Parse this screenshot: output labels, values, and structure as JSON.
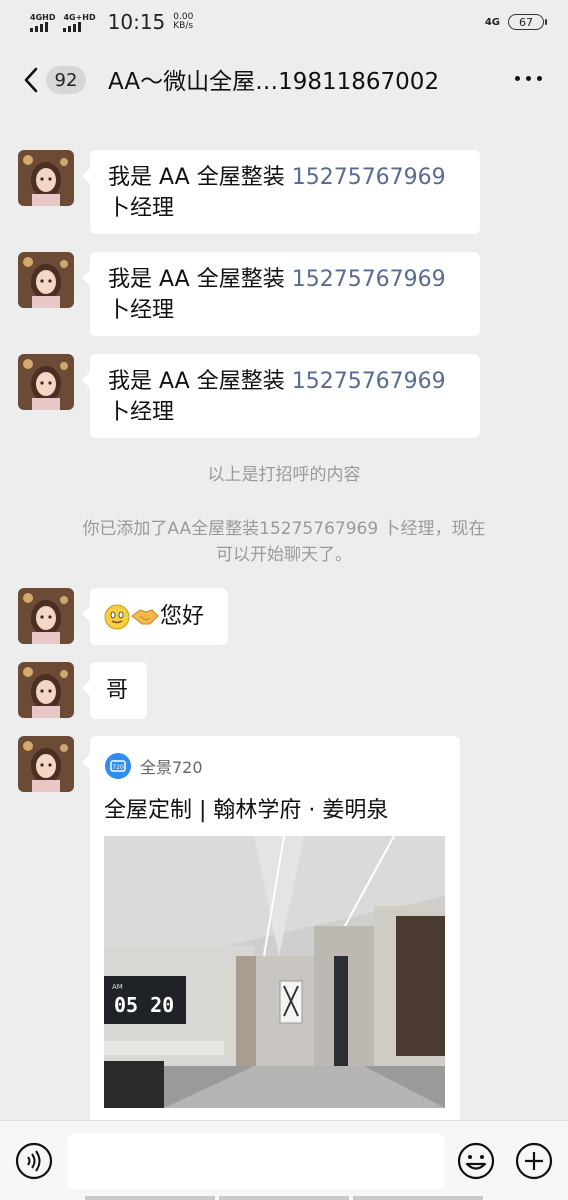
{
  "status_bar": {
    "sim1_label": "4GHD",
    "sim2_label": "4G+HD",
    "time": "10:15",
    "speed_value": "0.00",
    "speed_unit": "KB/s",
    "network": "4G",
    "battery": "67"
  },
  "header": {
    "unread_count": "92",
    "title": "AA～微山全屋…19811867002"
  },
  "messages": [
    {
      "text": "我是 AA 全屋整装 ",
      "phone": "15275767969",
      "text2": "卜经理"
    },
    {
      "text": "我是 AA 全屋整装 ",
      "phone": "15275767969",
      "text2": "卜经理"
    },
    {
      "text": "我是 AA 全屋整装 ",
      "phone": "15275767969",
      "text2": "卜经理"
    }
  ],
  "system_notes": {
    "greeting_note": "以上是打招呼的内容",
    "added_note_line1": "你已添加了AA全屋整装15275767969 卜经理，现在",
    "added_note_line2": "可以开始聊天了。"
  },
  "chat": {
    "hello_text": "您好",
    "ge_text": "哥"
  },
  "card": {
    "source": "全景720",
    "source_logo_text": "720",
    "title": "全屋定制 | 翰林学府 · 姜明泉",
    "clock_am": "AM",
    "clock_time": "05 20"
  },
  "colors": {
    "background": "#ededed",
    "bubble": "#ffffff",
    "link": "#576b95",
    "system_text": "#9a9a9a"
  },
  "icons": {
    "back": "chevron-left-icon",
    "more": "more-dots-icon",
    "voice": "voice-icon",
    "emoji": "emoji-icon",
    "plus": "plus-icon"
  }
}
